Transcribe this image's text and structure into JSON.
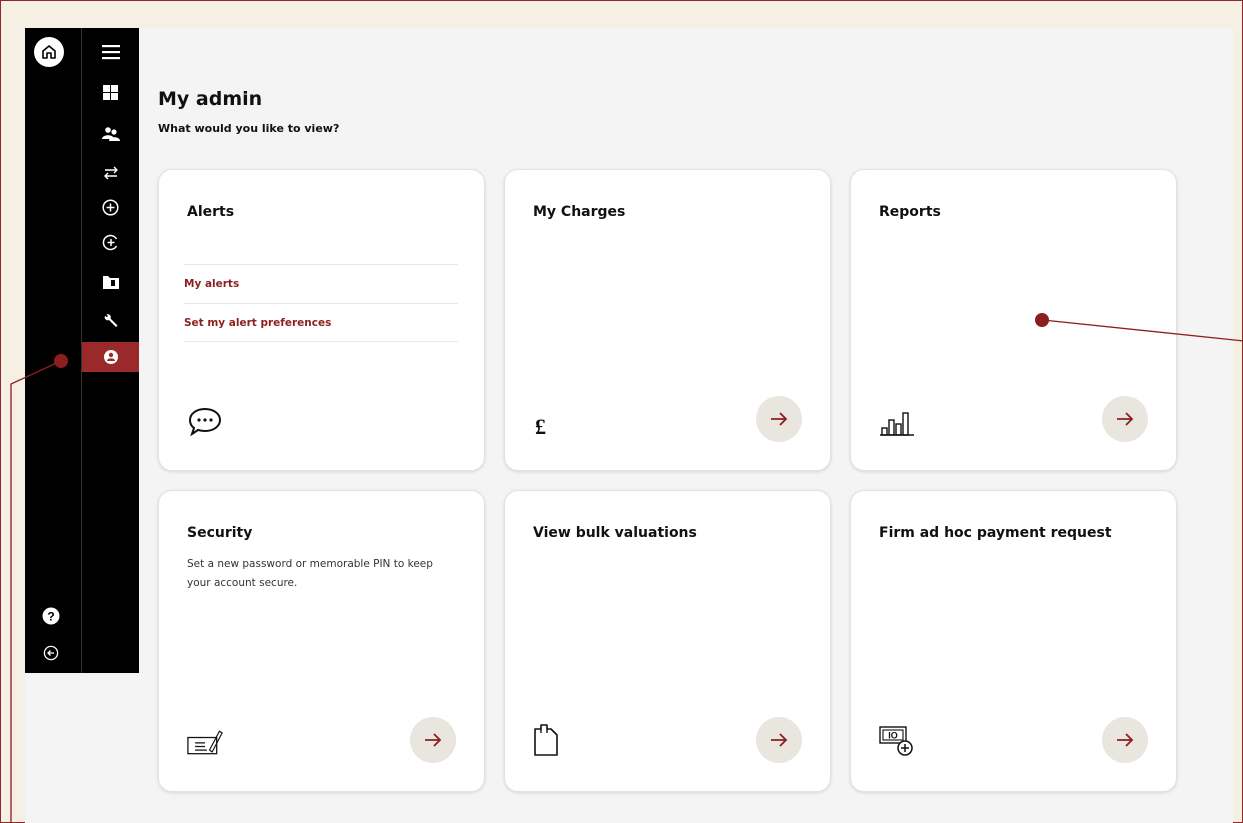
{
  "page": {
    "title": "My admin",
    "subtitle": "What would you like to view?"
  },
  "sidebar": {
    "rail": [
      "home-icon",
      "help-icon",
      "logout-icon"
    ],
    "items": [
      {
        "name": "menu-icon",
        "active": false
      },
      {
        "name": "dashboard-icon",
        "active": false
      },
      {
        "name": "users-icon",
        "active": false
      },
      {
        "name": "transfer-icon",
        "active": false
      },
      {
        "name": "add-icon",
        "active": false
      },
      {
        "name": "add-currency-icon",
        "active": false
      },
      {
        "name": "folder-icon",
        "active": false
      },
      {
        "name": "wrench-icon",
        "active": false
      },
      {
        "name": "account-icon",
        "active": true
      }
    ]
  },
  "cards": [
    {
      "title": "Alerts",
      "links": [
        "My alerts",
        "Set my alert preferences"
      ],
      "icon": "chat-icon",
      "has_arrow": false
    },
    {
      "title": "My Charges",
      "icon": "pound-icon",
      "has_arrow": true
    },
    {
      "title": "Reports",
      "icon": "bar-chart-icon",
      "has_arrow": true
    },
    {
      "title": "Security",
      "description": "Set a new password or memorable PIN to keep your account secure.",
      "icon": "cheque-icon",
      "has_arrow": true
    },
    {
      "title": "View bulk valuations",
      "icon": "document-icon",
      "has_arrow": true
    },
    {
      "title": "Firm ad hoc payment request",
      "icon": "payment-request-icon",
      "has_arrow": true
    }
  ],
  "colors": {
    "accent": "#8b1f1f",
    "active_nav": "#9a2a2a",
    "sidebar": "#000000",
    "arrow_bg": "#e9e5df"
  }
}
